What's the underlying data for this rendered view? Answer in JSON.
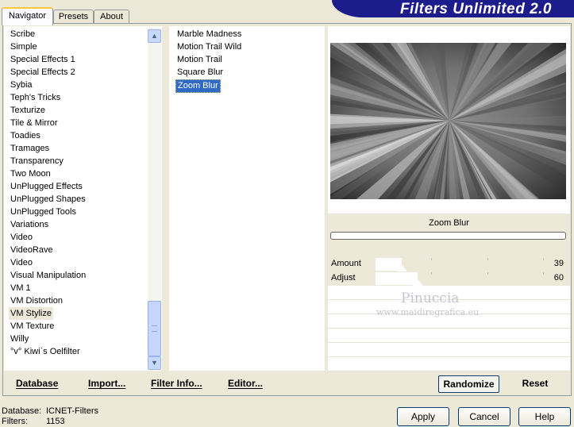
{
  "window": {
    "title": "Filters Unlimited 2.0",
    "tabs": [
      {
        "label": "Navigator",
        "active": true
      },
      {
        "label": "Presets",
        "active": false
      },
      {
        "label": "About",
        "active": false
      }
    ]
  },
  "categories": {
    "items": [
      "Scribe",
      "Simple",
      "Special Effects 1",
      "Special Effects 2",
      "Sybia",
      "Teph's Tricks",
      "Texturize",
      "Tile & Mirror",
      "Toadies",
      "Tramages",
      "Transparency",
      "Two Moon",
      "UnPlugged Effects",
      "UnPlugged Shapes",
      "UnPlugged Tools",
      "Variations",
      "Video",
      "VideoRave",
      "Video",
      "Visual Manipulation",
      "VM 1",
      "VM Distortion",
      "VM Stylize",
      "VM Texture",
      "Willy",
      "°v° Kiwi`s Oelfilter"
    ],
    "selected": "VM Stylize"
  },
  "filters": {
    "items": [
      "Marble Madness",
      "Motion Trail Wild",
      "Motion Trail",
      "Square Blur",
      "Zoom Blur"
    ],
    "selected": "Zoom Blur"
  },
  "preview": {
    "filter_name": "Zoom Blur",
    "progress": 0
  },
  "parameters": [
    {
      "label": "Amount",
      "value": "39",
      "level": 0.15
    },
    {
      "label": "Adjust",
      "value": "60",
      "level": 0.24
    }
  ],
  "watermark": {
    "line1": "Pinuccia",
    "line2": "www.maidiregrafica.eu"
  },
  "bottom_bar": {
    "database": "Database",
    "import": "Import...",
    "filter_info": "Filter Info...",
    "editor": "Editor...",
    "randomize": "Randomize",
    "reset": "Reset"
  },
  "status": {
    "database_label": "Database:",
    "database_value": "ICNET-Filters",
    "filters_label": "Filters:",
    "filters_value": "1153"
  },
  "buttons": {
    "apply": "Apply",
    "cancel": "Cancel",
    "help": "Help"
  }
}
